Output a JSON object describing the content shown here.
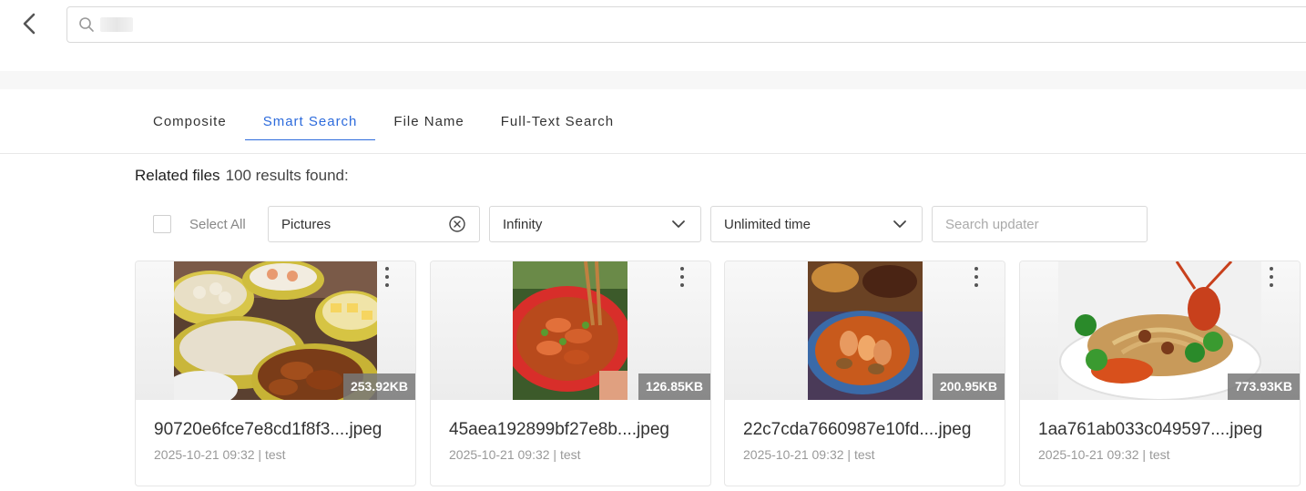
{
  "search": {
    "value": "",
    "placeholder": ""
  },
  "tabs": [
    {
      "label": "Composite"
    },
    {
      "label": "Smart Search"
    },
    {
      "label": "File Name"
    },
    {
      "label": "Full-Text Search"
    }
  ],
  "results": {
    "title": "Related files",
    "count_text": "100 results found:"
  },
  "filters": {
    "select_all_label": "Select All",
    "file_type": "Pictures",
    "size": "Infinity",
    "time": "Unlimited time",
    "updater_placeholder": "Search updater"
  },
  "files": [
    {
      "name": "90720e6fce7e8cd1f8f3....jpeg",
      "size": "253.92KB",
      "meta": "2025-10-21 09:32 | test"
    },
    {
      "name": "45aea192899bf27e8b....jpeg",
      "size": "126.85KB",
      "meta": "2025-10-21 09:32 | test"
    },
    {
      "name": "22c7cda7660987e10fd....jpeg",
      "size": "200.95KB",
      "meta": "2025-10-21 09:32 | test"
    },
    {
      "name": "1aa761ab033c049597....jpeg",
      "size": "773.93KB",
      "meta": "2025-10-21 09:32 | test"
    }
  ],
  "colors": {
    "accent": "#2d6bdc",
    "badge_bg": "#787878"
  }
}
